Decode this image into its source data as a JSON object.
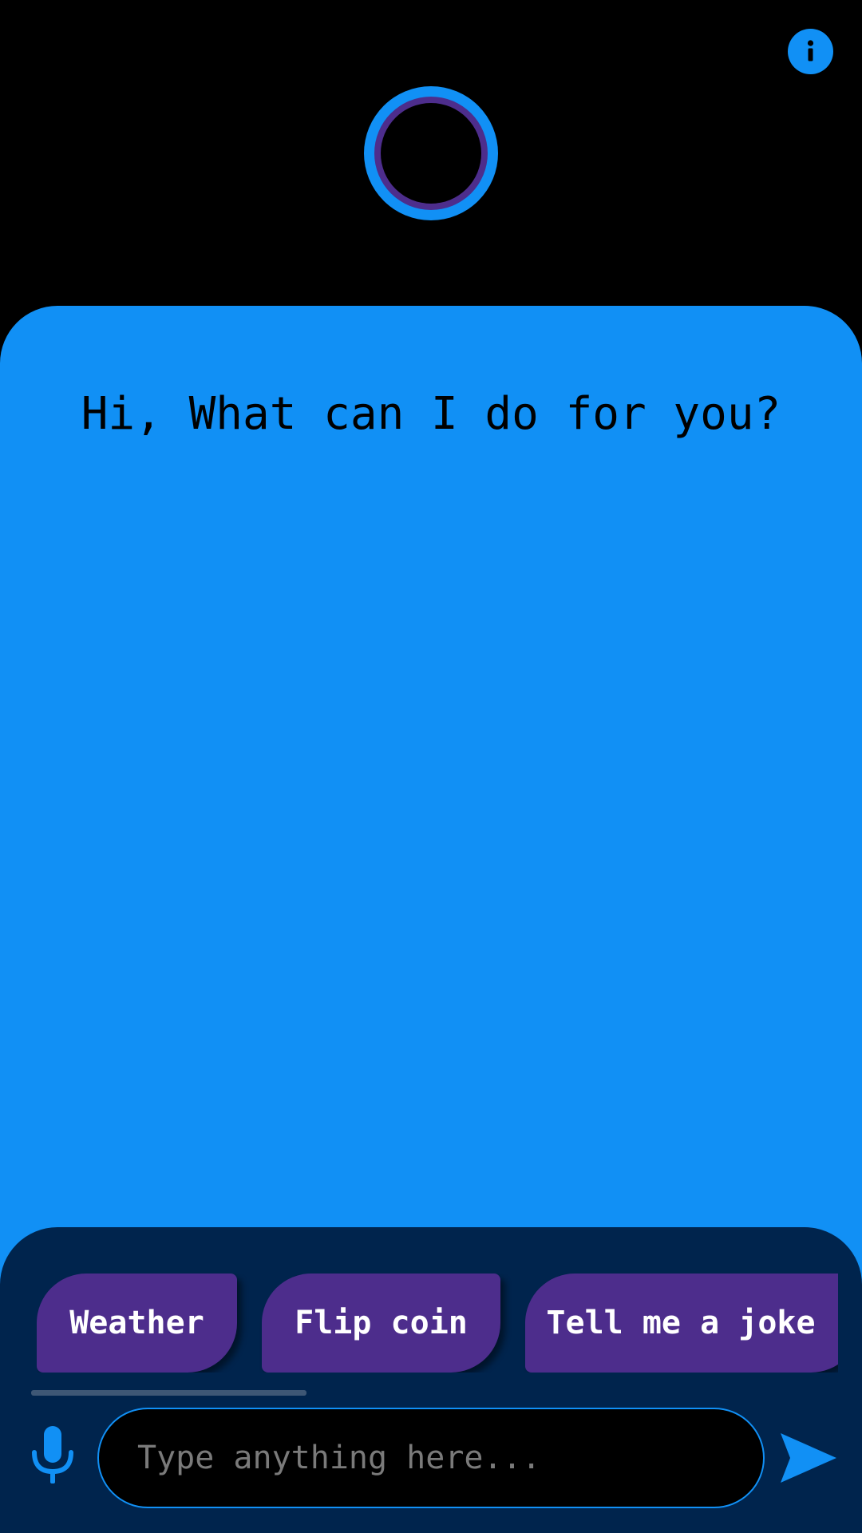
{
  "header": {
    "info_icon": "info-icon",
    "orb_icon": "assistant-orb"
  },
  "chat": {
    "greeting": "Hi, What can I do for you?"
  },
  "suggestions": [
    {
      "label": "Weather"
    },
    {
      "label": "Flip coin"
    },
    {
      "label": "Tell me a joke"
    }
  ],
  "composer": {
    "placeholder": "Type anything here...",
    "value": "",
    "mic_icon": "microphone-icon",
    "send_icon": "send-icon"
  },
  "colors": {
    "accent": "#1190f5",
    "chip_background": "#4d2d8c",
    "bottom_panel": "#00244d",
    "background": "#000000"
  }
}
